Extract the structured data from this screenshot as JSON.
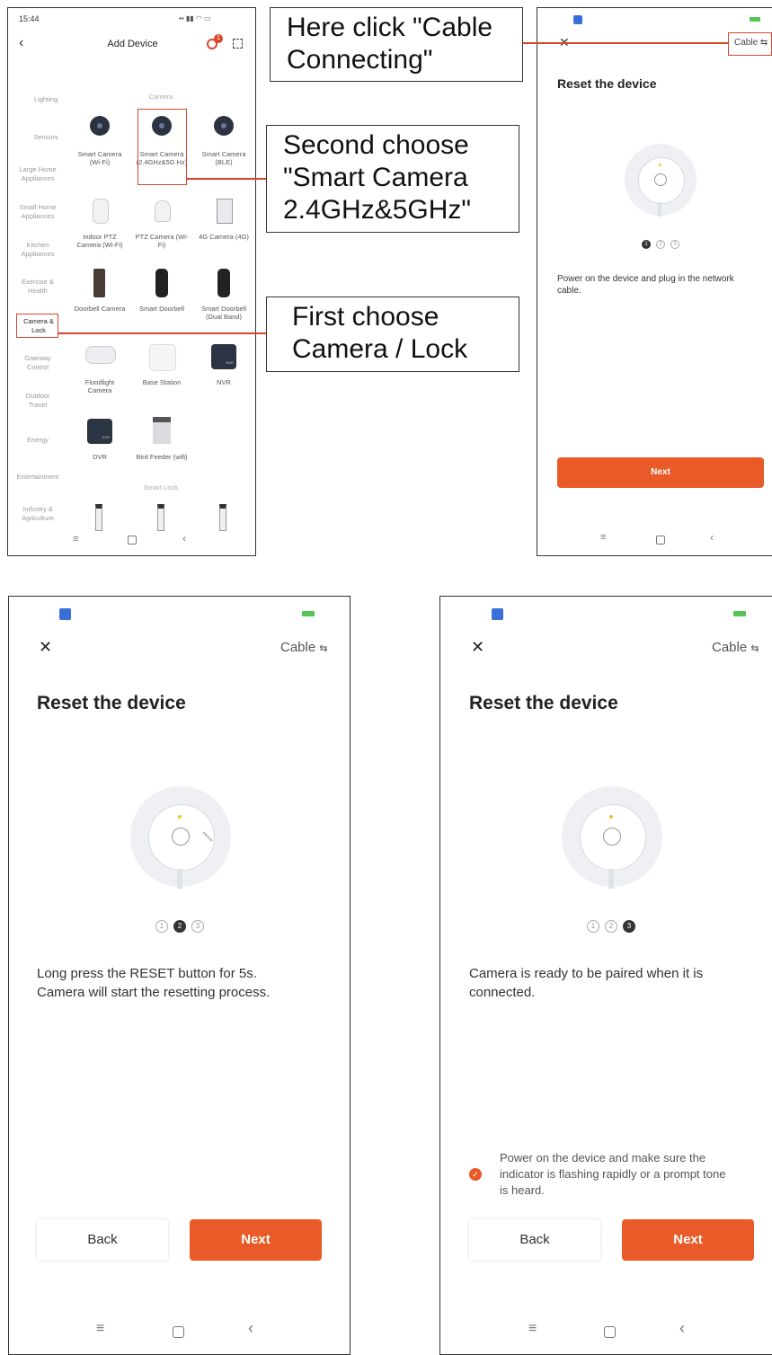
{
  "panel1": {
    "time": "15:44",
    "title": "Add Device",
    "badge": "1",
    "categories": [
      "Lighting",
      "Sensors",
      "Large Home Appliances",
      "Small Home Appliances",
      "Kitchen Appliances",
      "Exercise & Health",
      "Camera & Lock",
      "Gateway Control",
      "Outdoor Travel",
      "Energy",
      "Entertainment",
      "Industry & Agriculture"
    ],
    "section_camera": "Camera",
    "section_lock": "Smart Lock",
    "devices": [
      {
        "label": "Smart Camera (Wi-Fi)"
      },
      {
        "label": "Smart Camera (2.4GHz&5G Hz)"
      },
      {
        "label": "Smart Camera (BLE)"
      },
      {
        "label": "Indoor PTZ Camera (Wi-Fi)"
      },
      {
        "label": "PTZ Camera (Wi-Fi)"
      },
      {
        "label": "4G Camera (4G)"
      },
      {
        "label": "Doorbell Camera"
      },
      {
        "label": "Smart Doorbell"
      },
      {
        "label": "Smart Doorbell (Dual Band)"
      },
      {
        "label": "Floodlight Camera"
      },
      {
        "label": "Base Station"
      },
      {
        "label": "NVR"
      },
      {
        "label": "DVR"
      },
      {
        "label": "Bird Feeder (wifi)"
      }
    ],
    "dvr_text": "DVR",
    "nvr_text": "NVR"
  },
  "callouts": {
    "cable": "Here click \"Cable Connecting\"",
    "second": "Second choose \"Smart Camera 2.4GHz&5GHz\"",
    "first": "First choose Camera / Lock"
  },
  "panel2": {
    "cable_label": "Cable",
    "title": "Reset the device",
    "steps": [
      "1",
      "2",
      "3"
    ],
    "description": "Power on the device and plug in the network cable.",
    "next": "Next"
  },
  "panel3": {
    "cable_label": "Cable",
    "title": "Reset the device",
    "steps": [
      "1",
      "2",
      "3"
    ],
    "description": "Long press the RESET button for 5s. Camera will start the resetting process.",
    "back": "Back",
    "next": "Next"
  },
  "panel4": {
    "cable_label": "Cable",
    "title": "Reset the device",
    "steps": [
      "1",
      "2",
      "3"
    ],
    "description": "Camera is ready to be paired when it is connected.",
    "confirm": "Power on the device and make sure the indicator is flashing rapidly or a prompt tone is heard.",
    "back": "Back",
    "next": "Next"
  },
  "icons": [
    "back-chevron-icon",
    "scan-icon",
    "close-icon",
    "cable-icon",
    "menu-icon",
    "home-icon",
    "back-icon",
    "check-icon"
  ],
  "colors": {
    "accent": "#e85a28",
    "annotation": "#d8462a",
    "led": "#f2c21b"
  }
}
